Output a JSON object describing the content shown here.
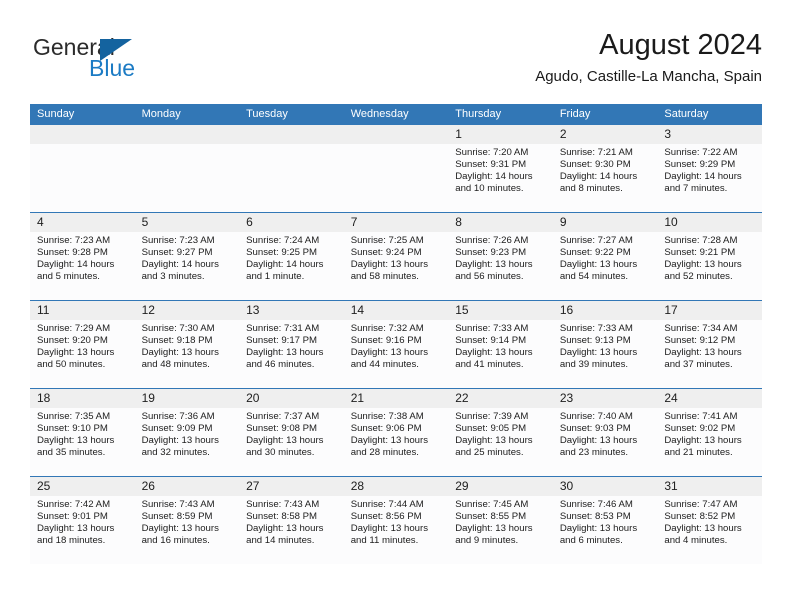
{
  "brand": {
    "name_part1": "General",
    "name_part2": "Blue",
    "triangle_color": "#14639f",
    "blue_color": "#1c7bc4"
  },
  "header": {
    "title": "August 2024",
    "subtitle": "Agudo, Castille-La Mancha, Spain"
  },
  "theme": {
    "header_blue": "#3277b6",
    "daynum_band_gray": "#efefef",
    "week_separator": "#3277b6",
    "text_color": "#202020"
  },
  "weekdays": [
    "Sunday",
    "Monday",
    "Tuesday",
    "Wednesday",
    "Thursday",
    "Friday",
    "Saturday"
  ],
  "labels": {
    "sunrise_prefix": "Sunrise: ",
    "sunset_prefix": "Sunset: ",
    "daylight_prefix": "Daylight: "
  },
  "weeks": [
    [
      {
        "day": "",
        "empty": true
      },
      {
        "day": "",
        "empty": true
      },
      {
        "day": "",
        "empty": true
      },
      {
        "day": "",
        "empty": true
      },
      {
        "day": "1",
        "sunrise": "Sunrise: 7:20 AM",
        "sunset": "Sunset: 9:31 PM",
        "daylight": "Daylight: 14 hours and 10 minutes."
      },
      {
        "day": "2",
        "sunrise": "Sunrise: 7:21 AM",
        "sunset": "Sunset: 9:30 PM",
        "daylight": "Daylight: 14 hours and 8 minutes."
      },
      {
        "day": "3",
        "sunrise": "Sunrise: 7:22 AM",
        "sunset": "Sunset: 9:29 PM",
        "daylight": "Daylight: 14 hours and 7 minutes."
      }
    ],
    [
      {
        "day": "4",
        "sunrise": "Sunrise: 7:23 AM",
        "sunset": "Sunset: 9:28 PM",
        "daylight": "Daylight: 14 hours and 5 minutes."
      },
      {
        "day": "5",
        "sunrise": "Sunrise: 7:23 AM",
        "sunset": "Sunset: 9:27 PM",
        "daylight": "Daylight: 14 hours and 3 minutes."
      },
      {
        "day": "6",
        "sunrise": "Sunrise: 7:24 AM",
        "sunset": "Sunset: 9:25 PM",
        "daylight": "Daylight: 14 hours and 1 minute."
      },
      {
        "day": "7",
        "sunrise": "Sunrise: 7:25 AM",
        "sunset": "Sunset: 9:24 PM",
        "daylight": "Daylight: 13 hours and 58 minutes."
      },
      {
        "day": "8",
        "sunrise": "Sunrise: 7:26 AM",
        "sunset": "Sunset: 9:23 PM",
        "daylight": "Daylight: 13 hours and 56 minutes."
      },
      {
        "day": "9",
        "sunrise": "Sunrise: 7:27 AM",
        "sunset": "Sunset: 9:22 PM",
        "daylight": "Daylight: 13 hours and 54 minutes."
      },
      {
        "day": "10",
        "sunrise": "Sunrise: 7:28 AM",
        "sunset": "Sunset: 9:21 PM",
        "daylight": "Daylight: 13 hours and 52 minutes."
      }
    ],
    [
      {
        "day": "11",
        "sunrise": "Sunrise: 7:29 AM",
        "sunset": "Sunset: 9:20 PM",
        "daylight": "Daylight: 13 hours and 50 minutes."
      },
      {
        "day": "12",
        "sunrise": "Sunrise: 7:30 AM",
        "sunset": "Sunset: 9:18 PM",
        "daylight": "Daylight: 13 hours and 48 minutes."
      },
      {
        "day": "13",
        "sunrise": "Sunrise: 7:31 AM",
        "sunset": "Sunset: 9:17 PM",
        "daylight": "Daylight: 13 hours and 46 minutes."
      },
      {
        "day": "14",
        "sunrise": "Sunrise: 7:32 AM",
        "sunset": "Sunset: 9:16 PM",
        "daylight": "Daylight: 13 hours and 44 minutes."
      },
      {
        "day": "15",
        "sunrise": "Sunrise: 7:33 AM",
        "sunset": "Sunset: 9:14 PM",
        "daylight": "Daylight: 13 hours and 41 minutes."
      },
      {
        "day": "16",
        "sunrise": "Sunrise: 7:33 AM",
        "sunset": "Sunset: 9:13 PM",
        "daylight": "Daylight: 13 hours and 39 minutes."
      },
      {
        "day": "17",
        "sunrise": "Sunrise: 7:34 AM",
        "sunset": "Sunset: 9:12 PM",
        "daylight": "Daylight: 13 hours and 37 minutes."
      }
    ],
    [
      {
        "day": "18",
        "sunrise": "Sunrise: 7:35 AM",
        "sunset": "Sunset: 9:10 PM",
        "daylight": "Daylight: 13 hours and 35 minutes."
      },
      {
        "day": "19",
        "sunrise": "Sunrise: 7:36 AM",
        "sunset": "Sunset: 9:09 PM",
        "daylight": "Daylight: 13 hours and 32 minutes."
      },
      {
        "day": "20",
        "sunrise": "Sunrise: 7:37 AM",
        "sunset": "Sunset: 9:08 PM",
        "daylight": "Daylight: 13 hours and 30 minutes."
      },
      {
        "day": "21",
        "sunrise": "Sunrise: 7:38 AM",
        "sunset": "Sunset: 9:06 PM",
        "daylight": "Daylight: 13 hours and 28 minutes."
      },
      {
        "day": "22",
        "sunrise": "Sunrise: 7:39 AM",
        "sunset": "Sunset: 9:05 PM",
        "daylight": "Daylight: 13 hours and 25 minutes."
      },
      {
        "day": "23",
        "sunrise": "Sunrise: 7:40 AM",
        "sunset": "Sunset: 9:03 PM",
        "daylight": "Daylight: 13 hours and 23 minutes."
      },
      {
        "day": "24",
        "sunrise": "Sunrise: 7:41 AM",
        "sunset": "Sunset: 9:02 PM",
        "daylight": "Daylight: 13 hours and 21 minutes."
      }
    ],
    [
      {
        "day": "25",
        "sunrise": "Sunrise: 7:42 AM",
        "sunset": "Sunset: 9:01 PM",
        "daylight": "Daylight: 13 hours and 18 minutes."
      },
      {
        "day": "26",
        "sunrise": "Sunrise: 7:43 AM",
        "sunset": "Sunset: 8:59 PM",
        "daylight": "Daylight: 13 hours and 16 minutes."
      },
      {
        "day": "27",
        "sunrise": "Sunrise: 7:43 AM",
        "sunset": "Sunset: 8:58 PM",
        "daylight": "Daylight: 13 hours and 14 minutes."
      },
      {
        "day": "28",
        "sunrise": "Sunrise: 7:44 AM",
        "sunset": "Sunset: 8:56 PM",
        "daylight": "Daylight: 13 hours and 11 minutes."
      },
      {
        "day": "29",
        "sunrise": "Sunrise: 7:45 AM",
        "sunset": "Sunset: 8:55 PM",
        "daylight": "Daylight: 13 hours and 9 minutes."
      },
      {
        "day": "30",
        "sunrise": "Sunrise: 7:46 AM",
        "sunset": "Sunset: 8:53 PM",
        "daylight": "Daylight: 13 hours and 6 minutes."
      },
      {
        "day": "31",
        "sunrise": "Sunrise: 7:47 AM",
        "sunset": "Sunset: 8:52 PM",
        "daylight": "Daylight: 13 hours and 4 minutes."
      }
    ]
  ]
}
